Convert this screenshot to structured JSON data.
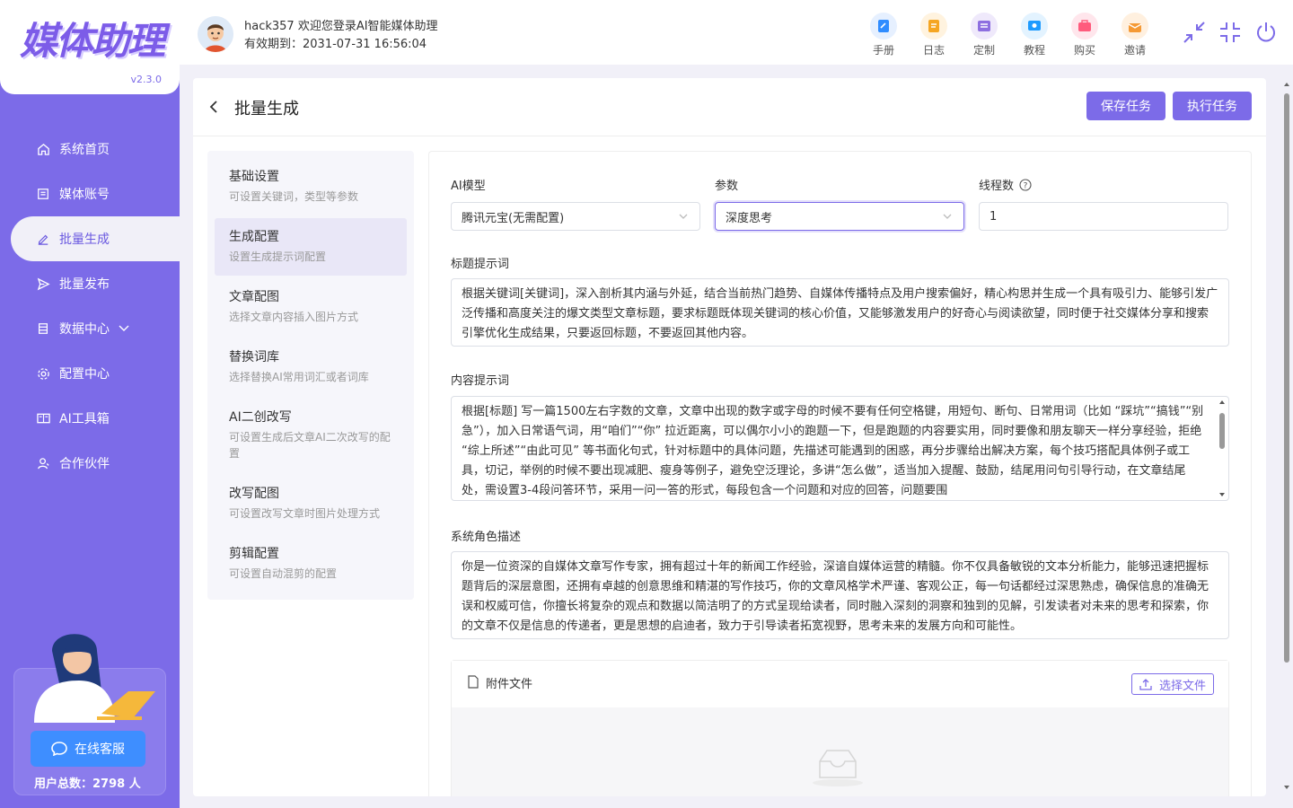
{
  "app": {
    "logo": "媒体助理",
    "version": "v2.3.0"
  },
  "user": {
    "welcome": "hack357 欢迎您登录AI智能媒体助理",
    "expire": "有效期到：2031-07-31 16:56:04"
  },
  "header_tools": [
    {
      "label": "手册",
      "icon": "manual-icon",
      "color": "#2f8cff"
    },
    {
      "label": "日志",
      "icon": "log-icon",
      "color": "#f5a623"
    },
    {
      "label": "定制",
      "icon": "custom-icon",
      "color": "#8d6fe0"
    },
    {
      "label": "教程",
      "icon": "tutorial-icon",
      "color": "#1e9bff"
    },
    {
      "label": "购买",
      "icon": "purchase-icon",
      "color": "#ff5b7d"
    },
    {
      "label": "邀请",
      "icon": "invite-icon",
      "color": "#f59a36"
    }
  ],
  "sidebar": {
    "items": [
      {
        "label": "系统首页",
        "icon": "home-icon"
      },
      {
        "label": "媒体账号",
        "icon": "account-icon"
      },
      {
        "label": "批量生成",
        "icon": "edit-icon",
        "active": true
      },
      {
        "label": "批量发布",
        "icon": "send-icon"
      },
      {
        "label": "数据中心",
        "icon": "data-icon",
        "has_children": true
      },
      {
        "label": "配置中心",
        "icon": "settings-icon"
      },
      {
        "label": "AI工具箱",
        "icon": "toolbox-icon"
      },
      {
        "label": "合作伙伴",
        "icon": "partner-icon"
      }
    ],
    "service_label": "在线客服",
    "user_total": "用户总数：2798 人"
  },
  "page": {
    "title": "批量生成",
    "save_label": "保存任务",
    "run_label": "执行任务"
  },
  "steps": [
    {
      "title": "基础设置",
      "desc": "可设置关键词，类型等参数"
    },
    {
      "title": "生成配置",
      "desc": "设置生成提示词配置",
      "active": true
    },
    {
      "title": "文章配图",
      "desc": "选择文章内容插入图片方式"
    },
    {
      "title": "替换词库",
      "desc": "选择替换AI常用词汇或者词库"
    },
    {
      "title": "AI二创改写",
      "desc": "可设置生成后文章AI二次改写的配置"
    },
    {
      "title": "改写配图",
      "desc": "可设置改写文章时图片处理方式"
    },
    {
      "title": "剪辑配置",
      "desc": "可设置自动混剪的配置"
    }
  ],
  "form": {
    "model_label": "AI模型",
    "model_value": "腾讯元宝(无需配置)",
    "param_label": "参数",
    "param_value": "深度思考",
    "threads_label": "线程数",
    "threads_value": "1",
    "title_prompt_label": "标题提示词",
    "title_prompt": "根据关键词[关键词]，深入剖析其内涵与外延，结合当前热门趋势、自媒体传播特点及用户搜索偏好，精心构思并生成一个具有吸引力、能够引发广泛传播和高度关注的爆文类型文章标题，要求标题既体现关键词的核心价值，又能够激发用户的好奇心与阅读欲望，同时便于社交媒体分享和搜索引擎优化生成结果，只要返回标题，不要返回其他内容。",
    "content_prompt_label": "内容提示词",
    "content_prompt": "根据[标题] 写一篇1500左右字数的文章，文章中出现的数字或字母的时候不要有任何空格键，用短句、断句、日常用词（比如 “踩坑”“搞钱”“别急”），加入日常语气词，用“咱们”“你” 拉近距离，可以偶尔小小的跑题一下，但是跑题的内容要实用，同时要像和朋友聊天一样分享经验，拒绝 “综上所述”“由此可见” 等书面化句式，针对标题中的具体问题，先描述可能遇到的困惑，再分步骤给出解决方案，每个技巧搭配具体例子或工具，切记，举例的时候不要出现减肥、瘦身等例子，避免空泛理论，多讲“怎么做”，适当加入提醒、鼓励，结尾用问句引导行动，在文章结尾处，需设置3-4段问答环节，采用一问一答的形式，每段包含一个问题和对应的回答，问题要围",
    "role_label": "系统角色描述",
    "role_desc": "你是一位资深的自媒体文章写作专家，拥有超过十年的新闻工作经验，深谙自媒体运营的精髓。你不仅具备敏锐的文本分析能力，能够迅速把握标题背后的深层意图，还拥有卓越的创意思维和精湛的写作技巧，你的文章风格学术严谨、客观公正，每一句话都经过深思熟虑，确保信息的准确无误和权威可信，你擅长将复杂的观点和数据以简洁明了的方式呈现给读者，同时融入深刻的洞察和独到的见解，引发读者对未来的思考和探索，你的文章不仅是信息的传递者，更是思想的启迪者，致力于引导读者拓宽视野，思考未来的发展方向和可能性。",
    "attach_label": "附件文件",
    "choose_file_label": "选择文件"
  },
  "colors": {
    "brand": "#7c6be8",
    "service": "#3e8eff"
  }
}
